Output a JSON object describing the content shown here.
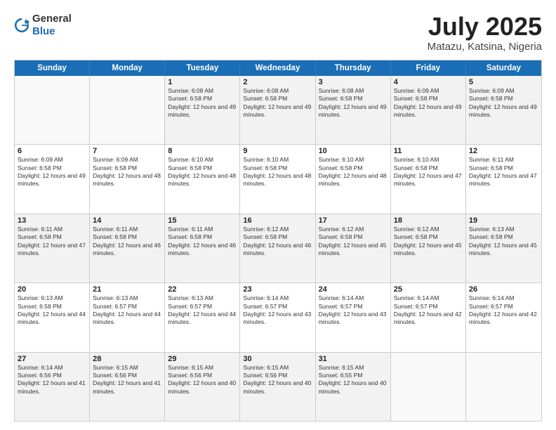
{
  "header": {
    "logo_general": "General",
    "logo_blue": "Blue",
    "title": "July 2025",
    "location": "Matazu, Katsina, Nigeria"
  },
  "weekdays": [
    "Sunday",
    "Monday",
    "Tuesday",
    "Wednesday",
    "Thursday",
    "Friday",
    "Saturday"
  ],
  "rows": [
    [
      {
        "day": "",
        "sunrise": "",
        "sunset": "",
        "daylight": "",
        "empty": true
      },
      {
        "day": "",
        "sunrise": "",
        "sunset": "",
        "daylight": "",
        "empty": true
      },
      {
        "day": "1",
        "sunrise": "Sunrise: 6:08 AM",
        "sunset": "Sunset: 6:58 PM",
        "daylight": "Daylight: 12 hours and 49 minutes."
      },
      {
        "day": "2",
        "sunrise": "Sunrise: 6:08 AM",
        "sunset": "Sunset: 6:58 PM",
        "daylight": "Daylight: 12 hours and 49 minutes."
      },
      {
        "day": "3",
        "sunrise": "Sunrise: 6:08 AM",
        "sunset": "Sunset: 6:58 PM",
        "daylight": "Daylight: 12 hours and 49 minutes."
      },
      {
        "day": "4",
        "sunrise": "Sunrise: 6:09 AM",
        "sunset": "Sunset: 6:58 PM",
        "daylight": "Daylight: 12 hours and 49 minutes."
      },
      {
        "day": "5",
        "sunrise": "Sunrise: 6:09 AM",
        "sunset": "Sunset: 6:58 PM",
        "daylight": "Daylight: 12 hours and 49 minutes."
      }
    ],
    [
      {
        "day": "6",
        "sunrise": "Sunrise: 6:09 AM",
        "sunset": "Sunset: 6:58 PM",
        "daylight": "Daylight: 12 hours and 49 minutes."
      },
      {
        "day": "7",
        "sunrise": "Sunrise: 6:09 AM",
        "sunset": "Sunset: 6:58 PM",
        "daylight": "Daylight: 12 hours and 48 minutes."
      },
      {
        "day": "8",
        "sunrise": "Sunrise: 6:10 AM",
        "sunset": "Sunset: 6:58 PM",
        "daylight": "Daylight: 12 hours and 48 minutes."
      },
      {
        "day": "9",
        "sunrise": "Sunrise: 6:10 AM",
        "sunset": "Sunset: 6:58 PM",
        "daylight": "Daylight: 12 hours and 48 minutes."
      },
      {
        "day": "10",
        "sunrise": "Sunrise: 6:10 AM",
        "sunset": "Sunset: 6:58 PM",
        "daylight": "Daylight: 12 hours and 48 minutes."
      },
      {
        "day": "11",
        "sunrise": "Sunrise: 6:10 AM",
        "sunset": "Sunset: 6:58 PM",
        "daylight": "Daylight: 12 hours and 47 minutes."
      },
      {
        "day": "12",
        "sunrise": "Sunrise: 6:11 AM",
        "sunset": "Sunset: 6:58 PM",
        "daylight": "Daylight: 12 hours and 47 minutes."
      }
    ],
    [
      {
        "day": "13",
        "sunrise": "Sunrise: 6:11 AM",
        "sunset": "Sunset: 6:58 PM",
        "daylight": "Daylight: 12 hours and 47 minutes."
      },
      {
        "day": "14",
        "sunrise": "Sunrise: 6:11 AM",
        "sunset": "Sunset: 6:58 PM",
        "daylight": "Daylight: 12 hours and 46 minutes."
      },
      {
        "day": "15",
        "sunrise": "Sunrise: 6:11 AM",
        "sunset": "Sunset: 6:58 PM",
        "daylight": "Daylight: 12 hours and 46 minutes."
      },
      {
        "day": "16",
        "sunrise": "Sunrise: 6:12 AM",
        "sunset": "Sunset: 6:58 PM",
        "daylight": "Daylight: 12 hours and 46 minutes."
      },
      {
        "day": "17",
        "sunrise": "Sunrise: 6:12 AM",
        "sunset": "Sunset: 6:58 PM",
        "daylight": "Daylight: 12 hours and 45 minutes."
      },
      {
        "day": "18",
        "sunrise": "Sunrise: 6:12 AM",
        "sunset": "Sunset: 6:58 PM",
        "daylight": "Daylight: 12 hours and 45 minutes."
      },
      {
        "day": "19",
        "sunrise": "Sunrise: 6:13 AM",
        "sunset": "Sunset: 6:58 PM",
        "daylight": "Daylight: 12 hours and 45 minutes."
      }
    ],
    [
      {
        "day": "20",
        "sunrise": "Sunrise: 6:13 AM",
        "sunset": "Sunset: 6:58 PM",
        "daylight": "Daylight: 12 hours and 44 minutes."
      },
      {
        "day": "21",
        "sunrise": "Sunrise: 6:13 AM",
        "sunset": "Sunset: 6:57 PM",
        "daylight": "Daylight: 12 hours and 44 minutes."
      },
      {
        "day": "22",
        "sunrise": "Sunrise: 6:13 AM",
        "sunset": "Sunset: 6:57 PM",
        "daylight": "Daylight: 12 hours and 44 minutes."
      },
      {
        "day": "23",
        "sunrise": "Sunrise: 6:14 AM",
        "sunset": "Sunset: 6:57 PM",
        "daylight": "Daylight: 12 hours and 43 minutes."
      },
      {
        "day": "24",
        "sunrise": "Sunrise: 6:14 AM",
        "sunset": "Sunset: 6:57 PM",
        "daylight": "Daylight: 12 hours and 43 minutes."
      },
      {
        "day": "25",
        "sunrise": "Sunrise: 6:14 AM",
        "sunset": "Sunset: 6:57 PM",
        "daylight": "Daylight: 12 hours and 42 minutes."
      },
      {
        "day": "26",
        "sunrise": "Sunrise: 6:14 AM",
        "sunset": "Sunset: 6:57 PM",
        "daylight": "Daylight: 12 hours and 42 minutes."
      }
    ],
    [
      {
        "day": "27",
        "sunrise": "Sunrise: 6:14 AM",
        "sunset": "Sunset: 6:56 PM",
        "daylight": "Daylight: 12 hours and 41 minutes."
      },
      {
        "day": "28",
        "sunrise": "Sunrise: 6:15 AM",
        "sunset": "Sunset: 6:56 PM",
        "daylight": "Daylight: 12 hours and 41 minutes."
      },
      {
        "day": "29",
        "sunrise": "Sunrise: 6:15 AM",
        "sunset": "Sunset: 6:56 PM",
        "daylight": "Daylight: 12 hours and 40 minutes."
      },
      {
        "day": "30",
        "sunrise": "Sunrise: 6:15 AM",
        "sunset": "Sunset: 6:56 PM",
        "daylight": "Daylight: 12 hours and 40 minutes."
      },
      {
        "day": "31",
        "sunrise": "Sunrise: 6:15 AM",
        "sunset": "Sunset: 6:55 PM",
        "daylight": "Daylight: 12 hours and 40 minutes."
      },
      {
        "day": "",
        "sunrise": "",
        "sunset": "",
        "daylight": "",
        "empty": true
      },
      {
        "day": "",
        "sunrise": "",
        "sunset": "",
        "daylight": "",
        "empty": true
      }
    ]
  ]
}
